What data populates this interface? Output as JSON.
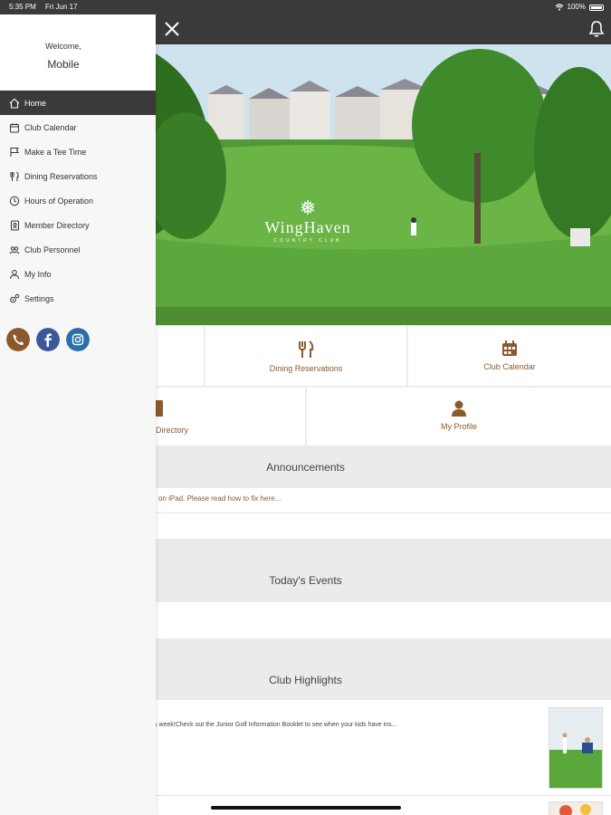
{
  "status_bar": {
    "time": "5:35 PM",
    "date": "Fri Jun 17",
    "battery": "100%"
  },
  "drawer": {
    "welcome": "Welcome,",
    "user_name": "Mobile",
    "items": [
      {
        "label": "Home",
        "icon": "home-icon"
      },
      {
        "label": "Club Calendar",
        "icon": "calendar-icon"
      },
      {
        "label": "Make a Tee Time",
        "icon": "flag-icon"
      },
      {
        "label": "Dining Reservations",
        "icon": "utensils-icon"
      },
      {
        "label": "Hours of Operation",
        "icon": "clock-icon"
      },
      {
        "label": "Member Directory",
        "icon": "address-book-icon"
      },
      {
        "label": "Club Personnel",
        "icon": "group-icon"
      },
      {
        "label": "My Info",
        "icon": "user-icon"
      },
      {
        "label": "Settings",
        "icon": "gears-icon"
      }
    ],
    "social": [
      {
        "name": "phone",
        "color": "#8b5a2b"
      },
      {
        "name": "facebook",
        "color": "#3b5998"
      },
      {
        "name": "instagram",
        "color": "#2a6fa8"
      }
    ]
  },
  "hero": {
    "logo_name": "WingHaven",
    "logo_sub": "COUNTRY CLUB"
  },
  "tiles": {
    "dining": "Dining Reservations",
    "calendar": "Club Calendar",
    "directory": "Directory",
    "profile": "My Profile"
  },
  "sections": {
    "announcements": {
      "title": "Announcements",
      "item": "on iPad. Please read how to fix here..."
    },
    "events": {
      "title": "Today's Events"
    },
    "highlights": {
      "title": "Club Highlights",
      "item": "s week!Check out the Junior Golf Information Booklet to see when your kids have ins..."
    }
  },
  "colors": {
    "accent": "#8b5a2b",
    "header": "#3a3a3a"
  }
}
